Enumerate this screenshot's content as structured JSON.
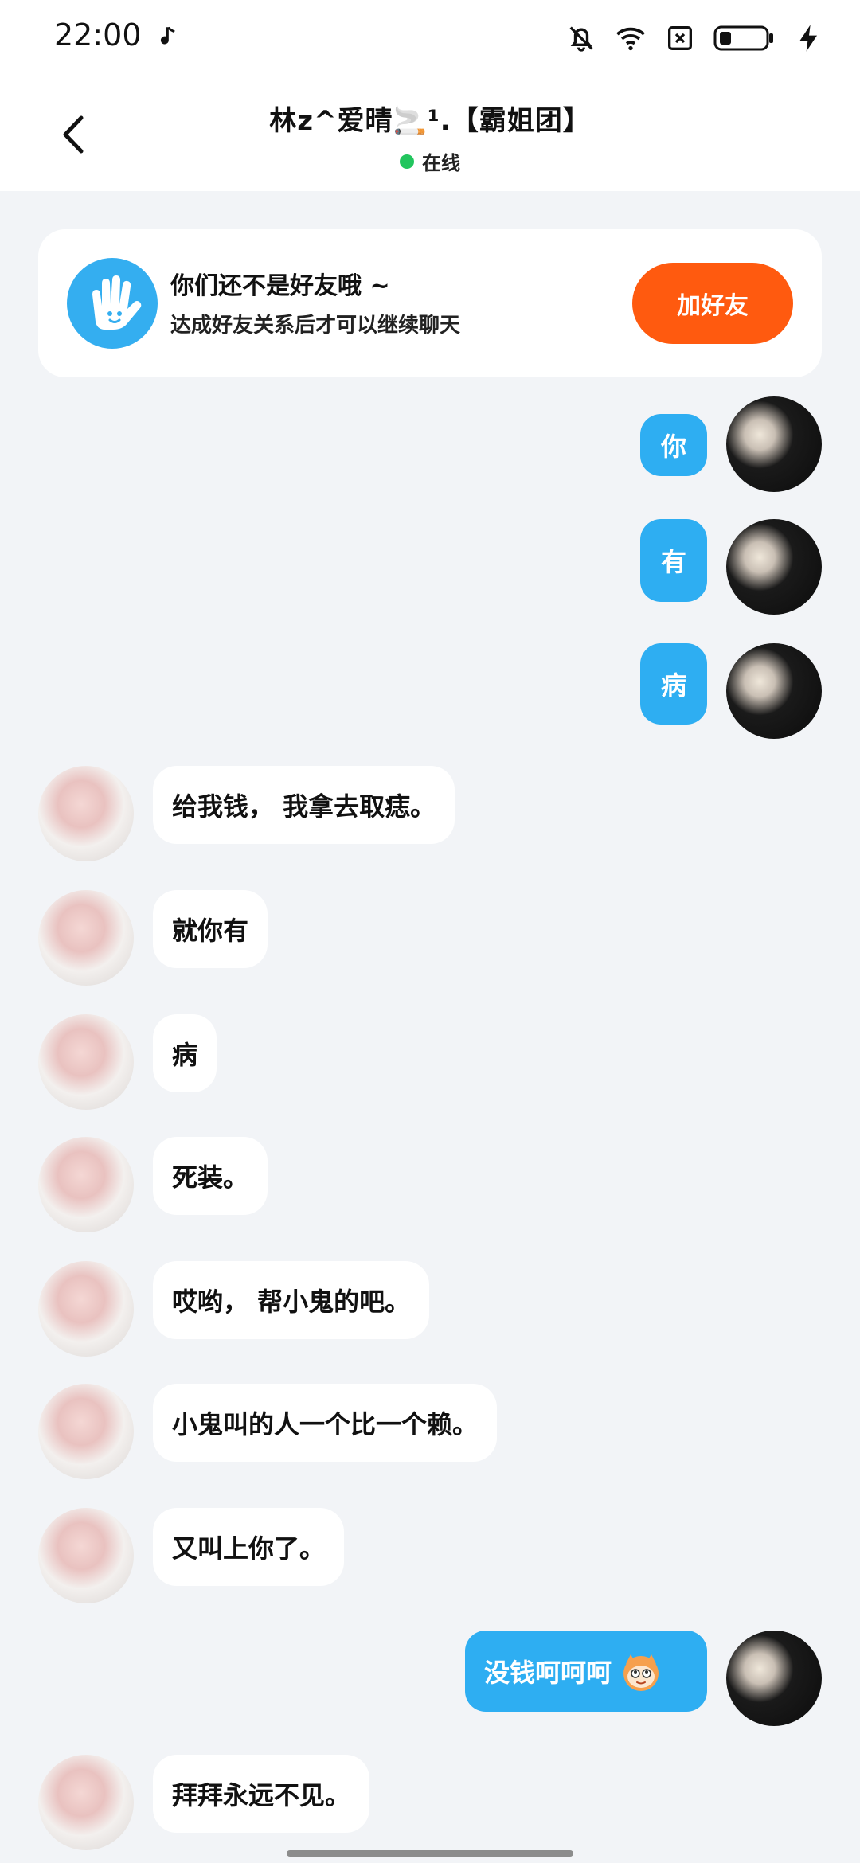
{
  "status_bar": {
    "time": "22:00"
  },
  "header": {
    "title": "林z^爱晴🚬¹.【霸姐团】",
    "status": "在线"
  },
  "friend_card": {
    "title": "你们还不是好友哦 ~",
    "subtitle": "达成好友关系后才可以继续聊天",
    "button": "加好友"
  },
  "messages": [
    {
      "side": "self",
      "text": "你"
    },
    {
      "side": "self",
      "text": "有"
    },
    {
      "side": "self",
      "text": "病"
    },
    {
      "side": "other",
      "text": "给我钱， 我拿去取痣。"
    },
    {
      "side": "other",
      "text": "就你有"
    },
    {
      "side": "other",
      "text": "病"
    },
    {
      "side": "other",
      "text": "死装。"
    },
    {
      "side": "other",
      "text": "哎哟， 帮小鬼的吧。"
    },
    {
      "side": "other",
      "text": "小鬼叫的人一个比一个赖。"
    },
    {
      "side": "other",
      "text": "又叫上你了。"
    },
    {
      "side": "self",
      "text": "没钱呵呵呵"
    },
    {
      "side": "other",
      "text": "拜拜永远不见。"
    }
  ],
  "colors": {
    "accent": "#2eaef2",
    "add_button": "#ff5a0f",
    "online": "#22c55e"
  }
}
